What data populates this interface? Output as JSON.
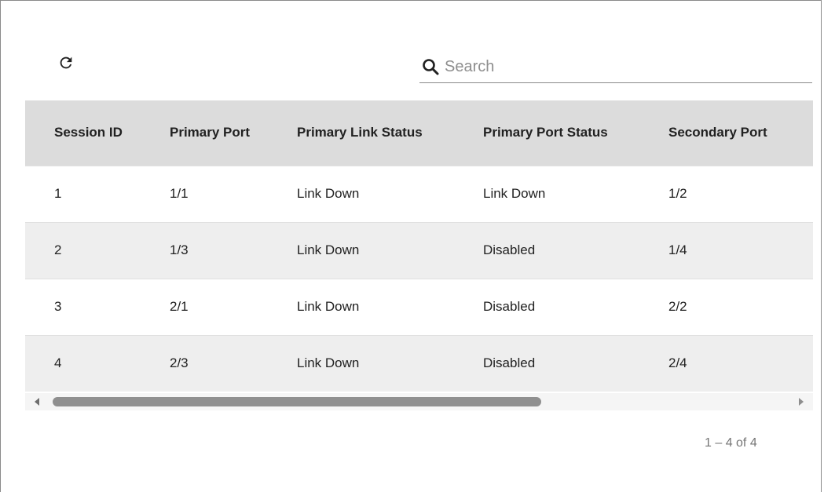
{
  "toolbar": {
    "refresh_icon": "refresh-icon",
    "search": {
      "icon": "search-icon",
      "placeholder": "Search",
      "value": ""
    }
  },
  "table": {
    "columns": [
      "Session ID",
      "Primary Port",
      "Primary Link Status",
      "Primary Port Status",
      "Secondary Port",
      ""
    ],
    "rows": [
      [
        "1",
        "1/1",
        "Link Down",
        "Link Down",
        "1/2",
        ""
      ],
      [
        "2",
        "1/3",
        "Link Down",
        "Disabled",
        "1/4",
        ""
      ],
      [
        "3",
        "2/1",
        "Link Down",
        "Disabled",
        "2/2",
        ""
      ],
      [
        "4",
        "2/3",
        "Link Down",
        "Disabled",
        "2/4",
        ""
      ]
    ]
  },
  "pagination": {
    "range_text": "1 – 4 of 4"
  },
  "colors": {
    "header_bg": "#dcdcdc",
    "stripe_bg": "#eeeeee",
    "muted_text": "#757575"
  }
}
